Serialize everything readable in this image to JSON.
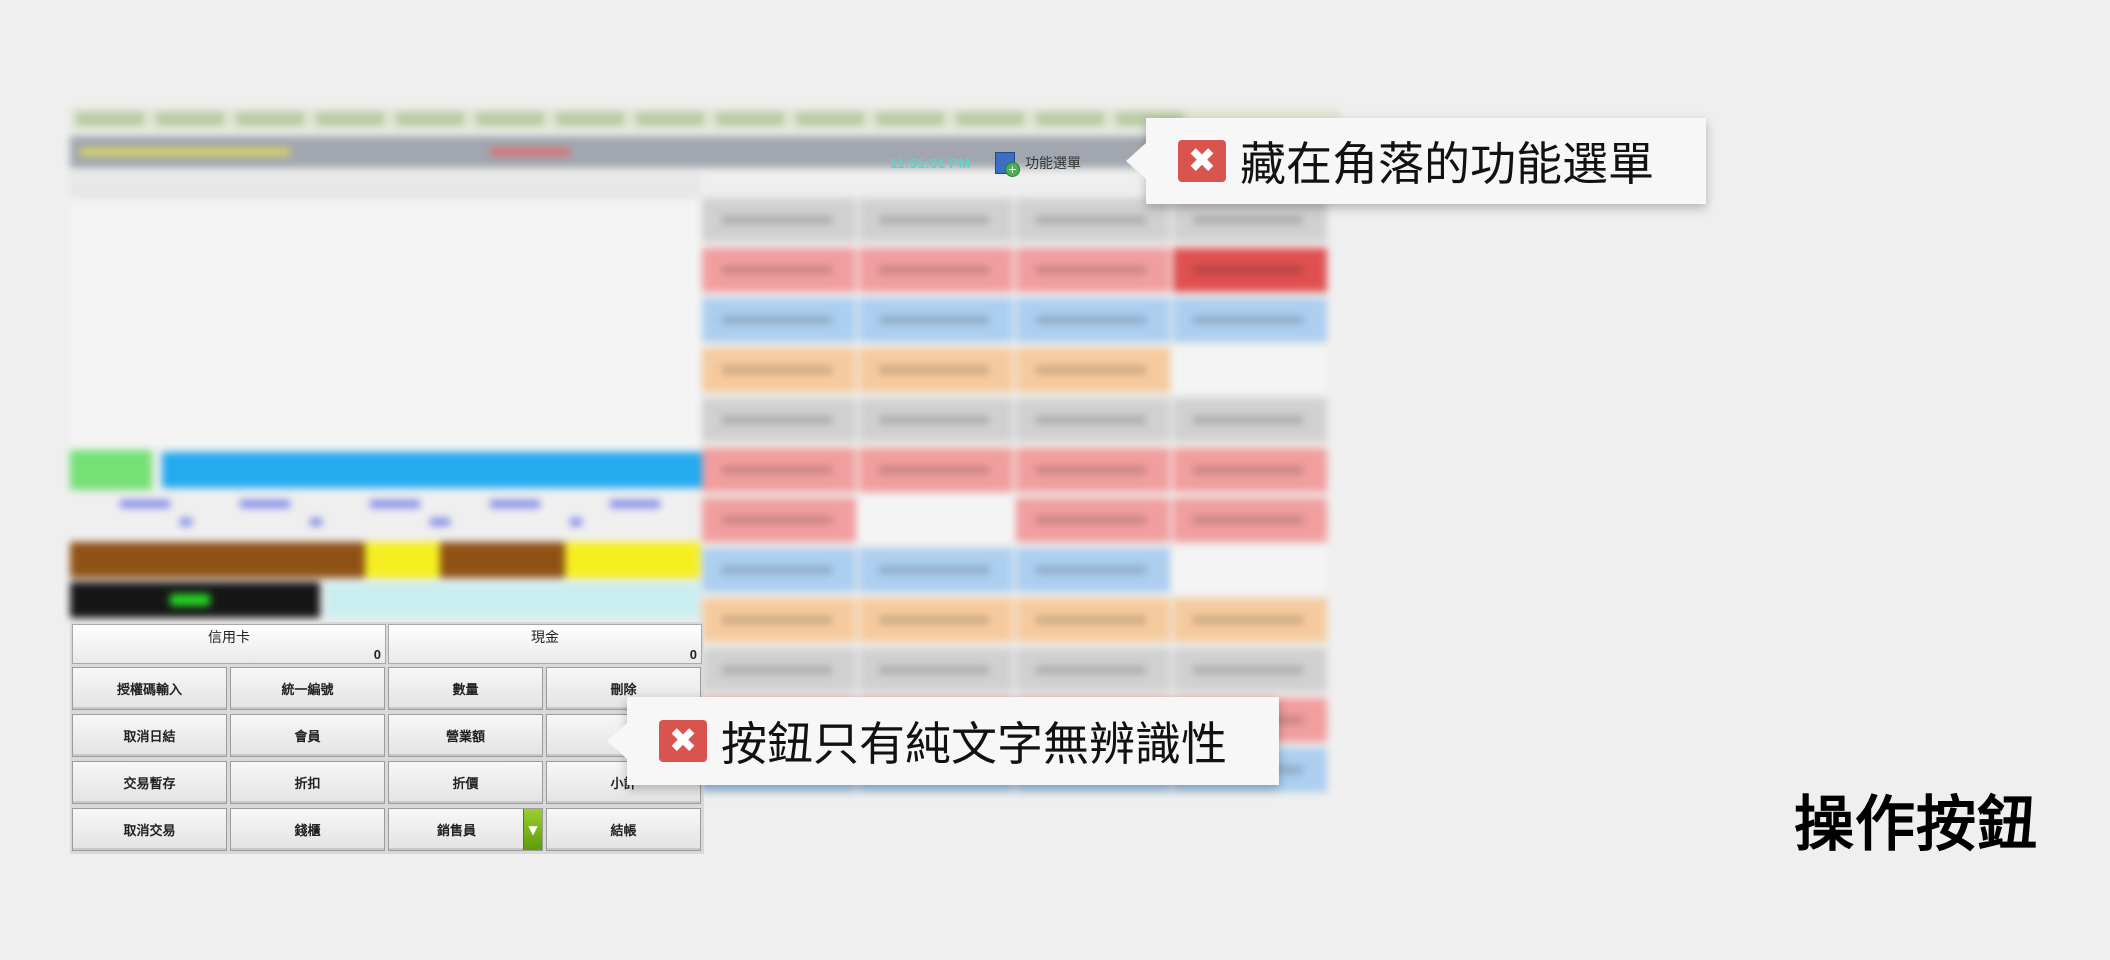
{
  "header": {
    "time": "11:51:31 PM",
    "function_menu_label": "功能選單"
  },
  "payment": {
    "credit_card": {
      "label": "信用卡",
      "amount": "0"
    },
    "cash": {
      "label": "現金",
      "amount": "0"
    }
  },
  "buttons": [
    [
      "授權碼輸入",
      "統一編號",
      "數量",
      "刪除"
    ],
    [
      "取消日結",
      "會員",
      "營業額",
      ""
    ],
    [
      "交易暫存",
      "折扣",
      "折價",
      "小計"
    ],
    [
      "取消交易",
      "錢櫃",
      "銷售員",
      "結帳"
    ]
  ],
  "annotations": {
    "corner_menu": "藏在角落的功能選單",
    "text_only_buttons": "按鈕只有純文字無辨識性"
  },
  "section_title": "操作按鈕",
  "colors": {
    "error_icon": "#d9534f",
    "clock": "#5fd3c6",
    "dropdown_green": "#7bb61c"
  },
  "icons": {
    "error": "close-icon",
    "function_menu": "document-add-icon",
    "dropdown": "chevron-down-icon"
  }
}
